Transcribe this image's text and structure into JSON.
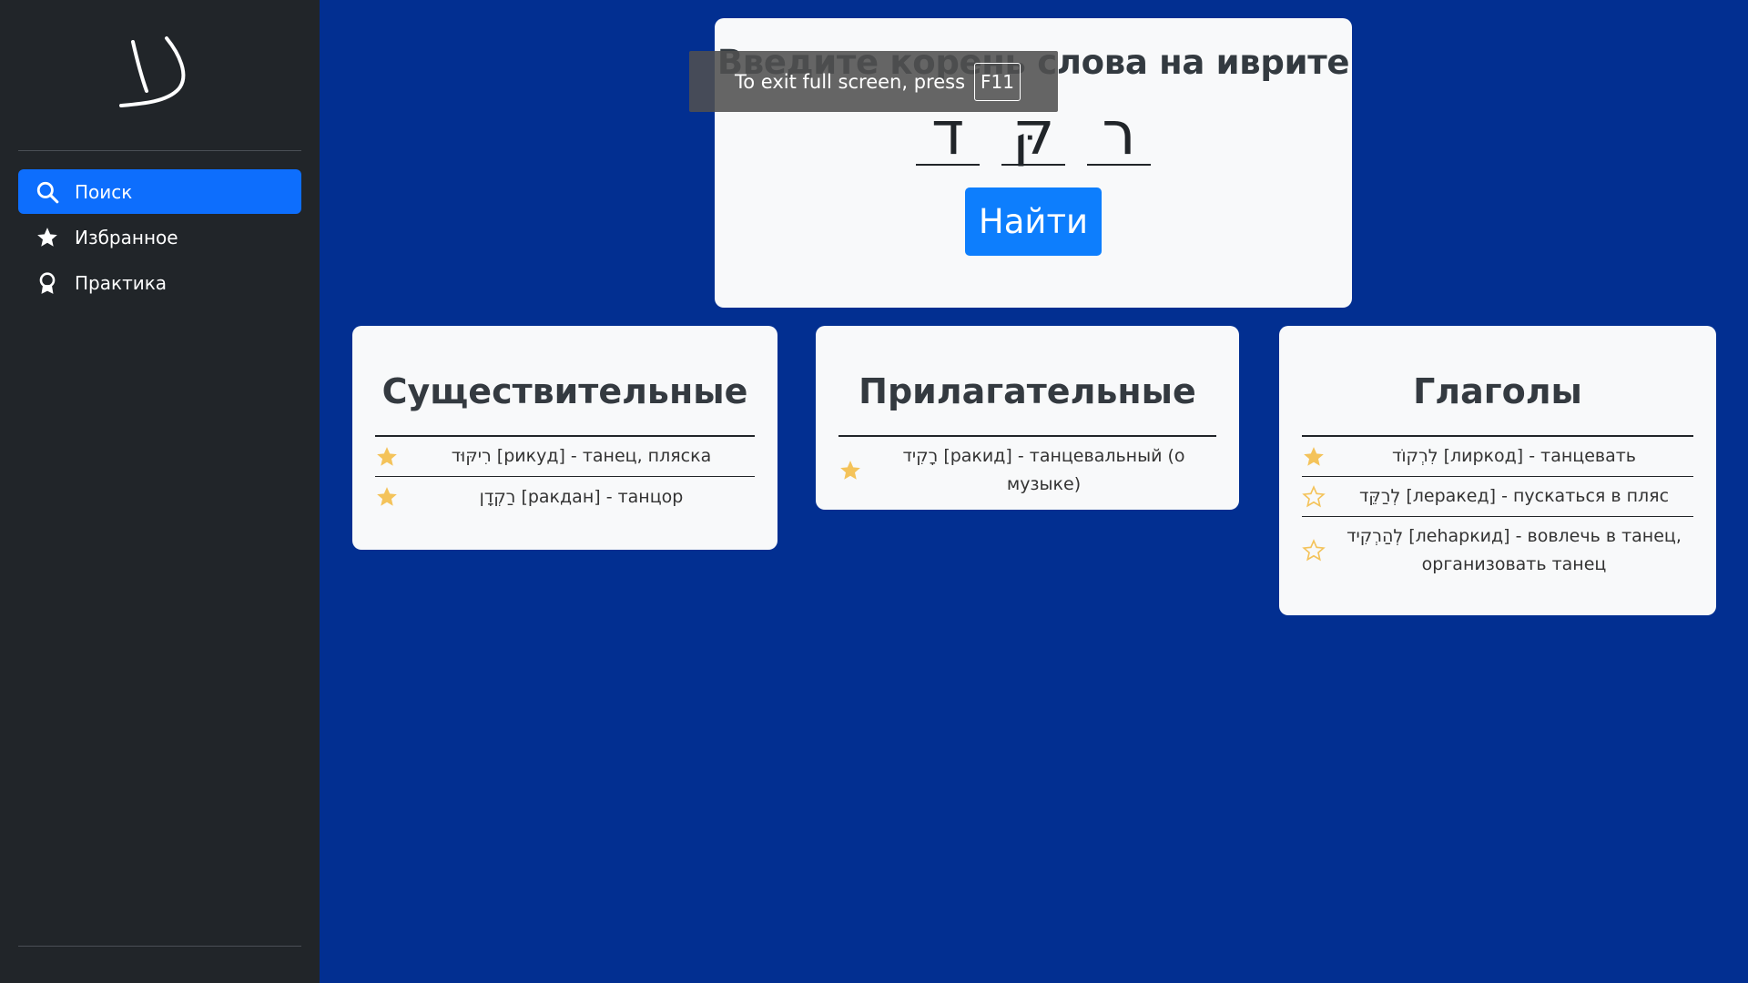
{
  "sidebar": {
    "logo_glyph": "ע",
    "items": [
      {
        "label": "Поиск",
        "icon": "search-icon",
        "active": true
      },
      {
        "label": "Избранное",
        "icon": "star-icon",
        "active": false
      },
      {
        "label": "Практика",
        "icon": "award-icon",
        "active": false
      }
    ]
  },
  "search": {
    "title": "Введите корень слова на иврите",
    "root_letters": [
      "ד",
      "קּ",
      "ר"
    ],
    "button_label": "Найти"
  },
  "fullscreen_toast": {
    "text": "To exit full screen, press",
    "key": "F11"
  },
  "cards": [
    {
      "title": "Существительные",
      "words": [
        {
          "text": "רִיקּוּד [рикуд] - танец, пляска",
          "favorite": true
        },
        {
          "text": "רַקְדָן [ракдан] - танцор",
          "favorite": true
        }
      ]
    },
    {
      "title": "Прилагательные",
      "words": [
        {
          "text": "רָקִיד [ракид] - танцевальный (о музыке)",
          "favorite": true
        }
      ]
    },
    {
      "title": "Глаголы",
      "words": [
        {
          "text": "לִרְקוֹד [лиркод] - танцевать",
          "favorite": true
        },
        {
          "text": "לְרַקֵּד [леракед] - пускаться в пляс",
          "favorite": false
        },
        {
          "text": "לְהַרְקִיד [леhаркид] - вовлечь в танец, организовать танец",
          "favorite": false
        }
      ]
    }
  ],
  "colors": {
    "accent": "#0d6efd",
    "background": "#022f91",
    "sidebar": "#212529",
    "star_filled": "#f4c35a",
    "star_outline": "#f4c35a"
  }
}
